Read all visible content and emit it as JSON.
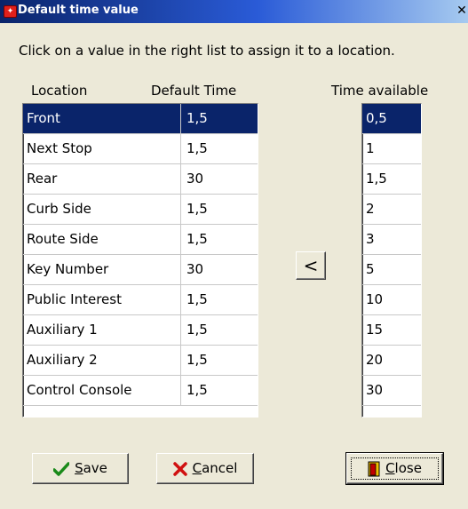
{
  "window": {
    "title": "Default time value",
    "close_glyph": "✕"
  },
  "instruction": "Click on a value in the right list to assign it to a location.",
  "headers": {
    "location": "Location",
    "default_time": "Default Time",
    "time_available": "Time available"
  },
  "locations": [
    {
      "name": "Front",
      "time": "1,5",
      "selected": true
    },
    {
      "name": "Next Stop",
      "time": "1,5"
    },
    {
      "name": "Rear",
      "time": "30"
    },
    {
      "name": "Curb Side",
      "time": "1,5"
    },
    {
      "name": "Route Side",
      "time": "1,5"
    },
    {
      "name": "Key Number",
      "time": "30"
    },
    {
      "name": "Public Interest",
      "time": "1,5"
    },
    {
      "name": "Auxiliary 1",
      "time": "1,5"
    },
    {
      "name": "Auxiliary 2",
      "time": "1,5"
    },
    {
      "name": "Control Console",
      "time": "1,5"
    }
  ],
  "time_available": [
    {
      "value": "0,5",
      "selected": true
    },
    {
      "value": "1"
    },
    {
      "value": "1,5"
    },
    {
      "value": "2"
    },
    {
      "value": "3"
    },
    {
      "value": "5"
    },
    {
      "value": "10"
    },
    {
      "value": "15"
    },
    {
      "value": "20"
    },
    {
      "value": "30"
    }
  ],
  "buttons": {
    "assign_glyph": "<",
    "save": {
      "mnemonic": "S",
      "rest": "ave",
      "icon": "checkmark-icon"
    },
    "cancel": {
      "mnemonic": "C",
      "rest": "ancel",
      "icon": "red-x-icon"
    },
    "close": {
      "mnemonic": "C",
      "rest": "lose",
      "icon": "exit-door-icon"
    }
  },
  "colors": {
    "selection": "#0a246a",
    "title_gradient_start": "#0a246a",
    "title_gradient_end": "#a6caf0",
    "dialog_bg": "#ece9d8"
  }
}
